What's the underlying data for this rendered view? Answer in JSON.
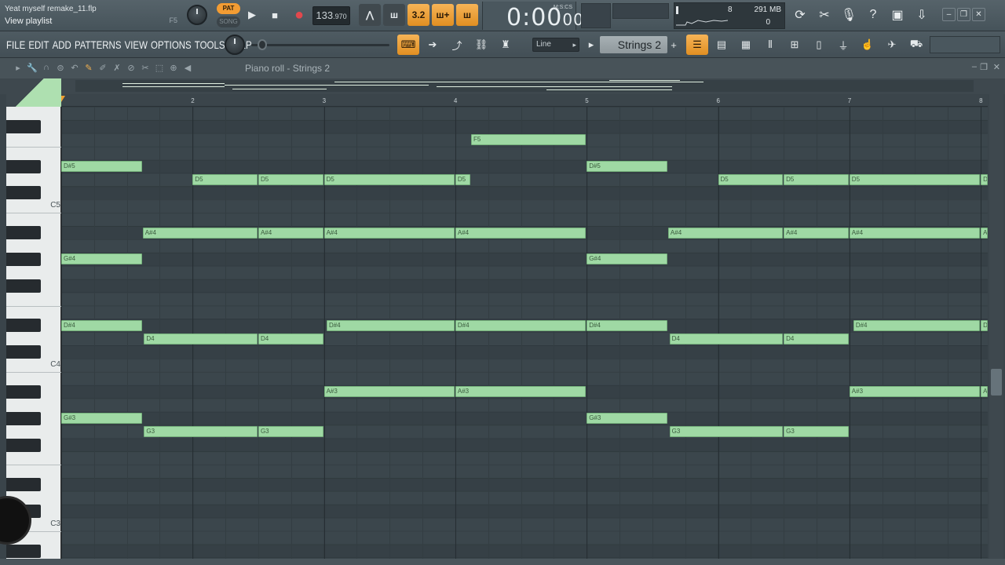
{
  "window": {
    "project_title": "Yeat myself remake_11.flp",
    "hint_text": "View playlist",
    "hint_key": "F5"
  },
  "transport": {
    "pat_label": "PAT",
    "song_label": "SONG",
    "tempo_main": "133",
    "tempo_frac": ".970",
    "time_display": "0:00",
    "time_small": "00",
    "time_format": "M:S:CS",
    "pattern_number_label": "3.2"
  },
  "cpu": {
    "voices": "8",
    "memory": "291 MB",
    "polyphony": "0"
  },
  "menu": [
    "FILE",
    "EDIT",
    "ADD",
    "PATTERNS",
    "VIEW",
    "OPTIONS",
    "TOOLS",
    "HELP"
  ],
  "toolbar": {
    "snap_mode": "Line",
    "channel_name": "Strings 2",
    "add_label": "+"
  },
  "piano_roll": {
    "title": "Piano roll - Strings 2",
    "bar_numbers": [
      "2",
      "3",
      "4",
      "5",
      "6",
      "7",
      "8"
    ],
    "octave_labels": [
      "C5",
      "C4",
      "C3"
    ]
  },
  "notes": [
    {
      "label": "F5",
      "row": "F5",
      "start": 4.12,
      "length": 0.88
    },
    {
      "label": "D#5",
      "row": "D#5",
      "start": 1.0,
      "length": 0.62
    },
    {
      "label": "D#5",
      "row": "D#5",
      "start": 5.0,
      "length": 0.62
    },
    {
      "label": "D5",
      "row": "D5",
      "start": 2.0,
      "length": 0.5
    },
    {
      "label": "D5",
      "row": "D5",
      "start": 2.5,
      "length": 0.5
    },
    {
      "label": "D5",
      "row": "D5",
      "start": 3.0,
      "length": 1.0
    },
    {
      "label": "D5",
      "row": "D5",
      "start": 4.0,
      "length": 0.12
    },
    {
      "label": "D5",
      "row": "D5",
      "start": 6.0,
      "length": 0.5
    },
    {
      "label": "D5",
      "row": "D5",
      "start": 6.5,
      "length": 0.5
    },
    {
      "label": "D5",
      "row": "D5",
      "start": 7.0,
      "length": 1.0
    },
    {
      "label": "D5",
      "row": "D5",
      "start": 8.0,
      "length": 0.1
    },
    {
      "label": "A#4",
      "row": "A#4",
      "start": 1.62,
      "length": 0.88
    },
    {
      "label": "A#4",
      "row": "A#4",
      "start": 2.5,
      "length": 0.5
    },
    {
      "label": "A#4",
      "row": "A#4",
      "start": 3.0,
      "length": 1.0
    },
    {
      "label": "A#4",
      "row": "A#4",
      "start": 4.0,
      "length": 1.0
    },
    {
      "label": "A#4",
      "row": "A#4",
      "start": 5.62,
      "length": 0.88
    },
    {
      "label": "A#4",
      "row": "A#4",
      "start": 6.5,
      "length": 0.5
    },
    {
      "label": "A#4",
      "row": "A#4",
      "start": 7.0,
      "length": 1.0
    },
    {
      "label": "A",
      "row": "A#4",
      "start": 8.0,
      "length": 0.1
    },
    {
      "label": "G#4",
      "row": "G#4",
      "start": 1.0,
      "length": 0.62
    },
    {
      "label": "G#4",
      "row": "G#4",
      "start": 5.0,
      "length": 0.62
    },
    {
      "label": "D#4",
      "row": "D#4",
      "start": 1.0,
      "length": 0.62
    },
    {
      "label": "D#4",
      "row": "D#4",
      "start": 3.02,
      "length": 0.98
    },
    {
      "label": "D#4",
      "row": "D#4",
      "start": 4.0,
      "length": 1.0
    },
    {
      "label": "D#4",
      "row": "D#4",
      "start": 5.0,
      "length": 0.62
    },
    {
      "label": "D#4",
      "row": "D#4",
      "start": 7.03,
      "length": 0.97
    },
    {
      "label": "D",
      "row": "D#4",
      "start": 8.0,
      "length": 0.1
    },
    {
      "label": "D4",
      "row": "D4",
      "start": 1.63,
      "length": 0.87
    },
    {
      "label": "D4",
      "row": "D4",
      "start": 2.5,
      "length": 0.5
    },
    {
      "label": "D4",
      "row": "D4",
      "start": 5.63,
      "length": 0.87
    },
    {
      "label": "D4",
      "row": "D4",
      "start": 6.5,
      "length": 0.5
    },
    {
      "label": "A#3",
      "row": "A#3",
      "start": 3.0,
      "length": 1.0
    },
    {
      "label": "A#3",
      "row": "A#3",
      "start": 4.0,
      "length": 1.0
    },
    {
      "label": "A#3",
      "row": "A#3",
      "start": 7.0,
      "length": 1.0
    },
    {
      "label": "A",
      "row": "A#3",
      "start": 8.0,
      "length": 0.1
    },
    {
      "label": "G#3",
      "row": "G#3",
      "start": 1.0,
      "length": 0.62
    },
    {
      "label": "G#3",
      "row": "G#3",
      "start": 5.0,
      "length": 0.62
    },
    {
      "label": "G3",
      "row": "G3",
      "start": 1.63,
      "length": 0.87
    },
    {
      "label": "G3",
      "row": "G3",
      "start": 2.5,
      "length": 0.5
    },
    {
      "label": "G3",
      "row": "G3",
      "start": 5.63,
      "length": 0.87
    },
    {
      "label": "G3",
      "row": "G3",
      "start": 6.5,
      "length": 0.5
    }
  ]
}
